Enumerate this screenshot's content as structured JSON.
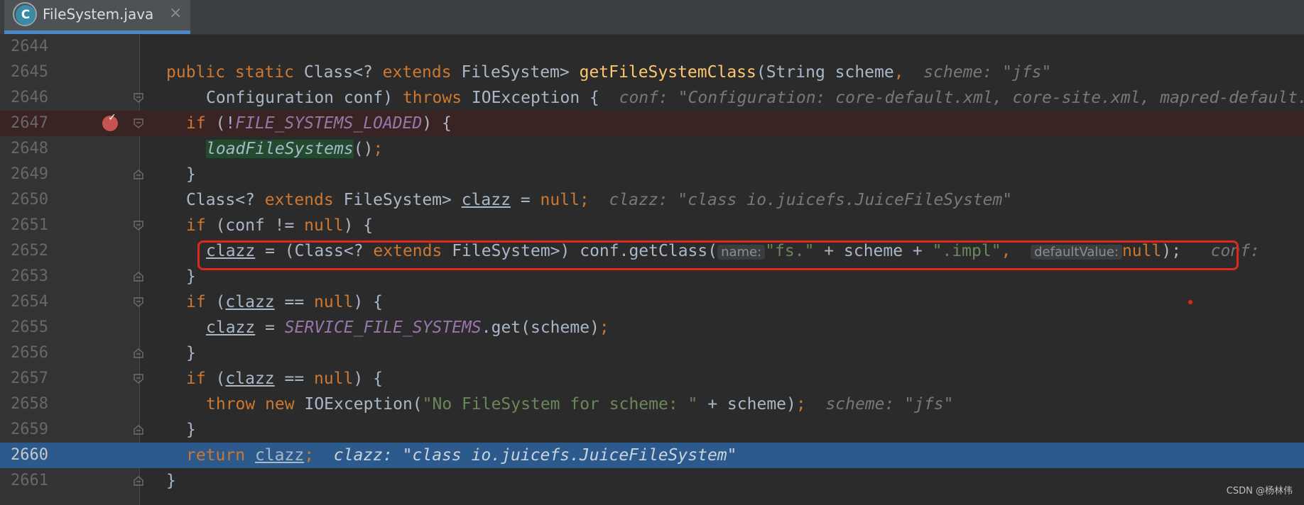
{
  "tab": {
    "title": "FileSystem.java",
    "icon_letter": "C",
    "icon": "java-class-icon",
    "close": "×"
  },
  "lines": [
    {
      "num": "2644"
    },
    {
      "num": "2645"
    },
    {
      "num": "2646"
    },
    {
      "num": "2647"
    },
    {
      "num": "2648"
    },
    {
      "num": "2649"
    },
    {
      "num": "2650"
    },
    {
      "num": "2651"
    },
    {
      "num": "2652"
    },
    {
      "num": "2653"
    },
    {
      "num": "2654"
    },
    {
      "num": "2655"
    },
    {
      "num": "2656"
    },
    {
      "num": "2657"
    },
    {
      "num": "2658"
    },
    {
      "num": "2659"
    },
    {
      "num": "2660"
    },
    {
      "num": "2661"
    }
  ],
  "code": {
    "l2645": {
      "t1": "public static ",
      "t2": "Class<? ",
      "t3": "extends ",
      "t4": "FileSystem> ",
      "t5": "getFileSystemClass",
      "t6": "(String scheme",
      "t7": ",",
      "hint": "scheme: \"jfs\""
    },
    "l2646": {
      "t1": "Configuration conf) ",
      "t2": "throws ",
      "t3": "IOException {",
      "hint": "conf: \"Configuration: core-default.xml, core-site.xml, mapred-default.xml"
    },
    "l2647": {
      "t1": "if ",
      "t2": "(!",
      "t3": "FILE_SYSTEMS_LOADED",
      "t4": ") {"
    },
    "l2648": {
      "t1": "loadFileSystems",
      "t2": "()",
      "t3": ";"
    },
    "l2649": {
      "t1": "}"
    },
    "l2650": {
      "t1": "Class<? ",
      "t2": "extends ",
      "t3": "FileSystem> ",
      "t4": "clazz",
      "t5": " = ",
      "t6": "null",
      "t7": ";",
      "hint": "clazz: \"class io.juicefs.JuiceFileSystem\""
    },
    "l2651": {
      "t1": "if ",
      "t2": "(conf != ",
      "t3": "null",
      "t4": ") {"
    },
    "l2652": {
      "t1": "clazz",
      "t2": " = (Class<? ",
      "t3": "extends ",
      "t4": "FileSystem>) conf.getClass(",
      "p1": "name:",
      "t5": "\"fs.\"",
      "t6": " + scheme + ",
      "t7": "\".impl\"",
      "t8": ", ",
      "p2": "defaultValue:",
      "t9": "null",
      "t10": ");",
      "hint": "conf:"
    },
    "l2653": {
      "t1": "}"
    },
    "l2654": {
      "t1": "if ",
      "t2": "(",
      "t3": "clazz",
      "t4": " == ",
      "t5": "null",
      "t6": ") {"
    },
    "l2655": {
      "t1": "clazz",
      "t2": " = ",
      "t3": "SERVICE_FILE_SYSTEMS",
      "t4": ".get(scheme)",
      "t5": ";"
    },
    "l2656": {
      "t1": "}"
    },
    "l2657": {
      "t1": "if ",
      "t2": "(",
      "t3": "clazz",
      "t4": " == ",
      "t5": "null",
      "t6": ") {"
    },
    "l2658": {
      "t1": "throw new ",
      "t2": "IOException(",
      "t3": "\"No FileSystem for scheme: \"",
      "t4": " + scheme)",
      "t5": ";",
      "hint": "scheme: \"jfs\""
    },
    "l2659": {
      "t1": "}"
    },
    "l2660": {
      "t1": "return ",
      "t2": "clazz",
      "t3": ";",
      "hint": "clazz: \"class io.juicefs.JuiceFileSystem\""
    },
    "l2661": {
      "t1": "}"
    }
  },
  "watermark": "CSDN @杨林伟",
  "colors": {
    "background": "#2b2b2b",
    "keyword": "#cc7832",
    "method": "#ffc66d",
    "string": "#6a8759",
    "static_field": "#9876aa",
    "breakpoint_line": "#3a2323",
    "current_line": "#2d5a8d",
    "annotation_box": "#e0261f"
  }
}
